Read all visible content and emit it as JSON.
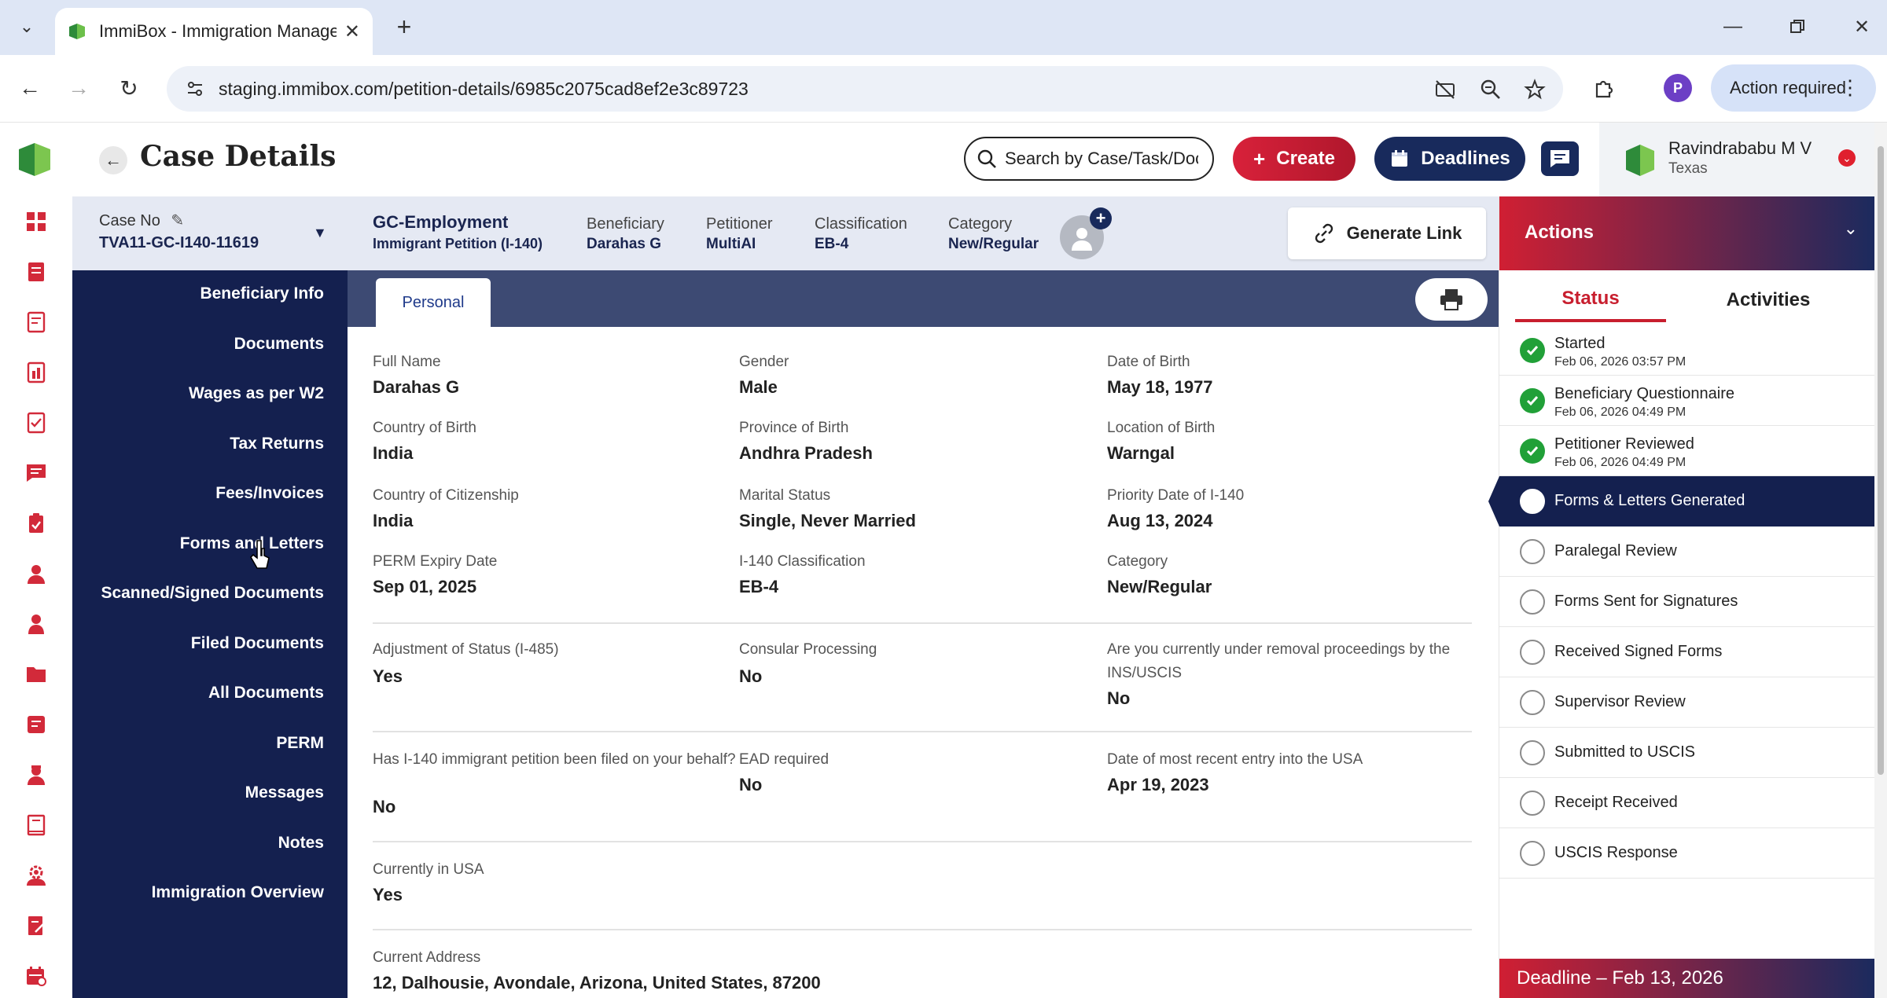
{
  "browser": {
    "tab_title": "ImmiBox - Immigration Manage",
    "url": "staging.immibox.com/petition-details/6985c2075cad8ef2e3c89723",
    "profile_initial": "P",
    "action_required": "Action required"
  },
  "header": {
    "title": "Case Details",
    "search_placeholder": "Search by Case/Task/Document",
    "create_label": "Create",
    "deadlines_label": "Deadlines",
    "user_name": "Ravindrababu M V",
    "user_location": "Texas"
  },
  "case": {
    "case_no_label": "Case No",
    "case_no": "TVA11-GC-I140-11619",
    "type_title": "GC-Employment",
    "type_subtitle": "Immigrant Petition (I-140)",
    "beneficiary_label": "Beneficiary",
    "beneficiary": "Darahas G",
    "petitioner_label": "Petitioner",
    "petitioner": "MultiAI",
    "classification_label": "Classification",
    "classification": "EB-4",
    "category_label": "Category",
    "category": "New/Regular",
    "generate_link": "Generate Link"
  },
  "side_nav": [
    "Beneficiary Info",
    "Documents",
    "Wages as per W2",
    "Tax Returns",
    "Fees/Invoices",
    "Forms and Letters",
    "Scanned/Signed Documents",
    "Filed Documents",
    "All Documents",
    "PERM",
    "Messages",
    "Notes",
    "Immigration Overview"
  ],
  "main": {
    "tab": "Personal",
    "fields": {
      "full_name": {
        "label": "Full Name",
        "value": "Darahas G"
      },
      "gender": {
        "label": "Gender",
        "value": "Male"
      },
      "dob": {
        "label": "Date of Birth",
        "value": "May 18, 1977"
      },
      "country_birth": {
        "label": "Country of Birth",
        "value": "India"
      },
      "province_birth": {
        "label": "Province of Birth",
        "value": "Andhra Pradesh"
      },
      "location_birth": {
        "label": "Location of Birth",
        "value": "Warngal"
      },
      "citizenship": {
        "label": "Country of Citizenship",
        "value": "India"
      },
      "marital": {
        "label": "Marital Status",
        "value": "Single, Never Married"
      },
      "priority_date": {
        "label": "Priority Date of I-140",
        "value": "Aug 13, 2024"
      },
      "perm_expiry": {
        "label": "PERM Expiry Date",
        "value": "Sep 01, 2025"
      },
      "i140_class": {
        "label": "I-140 Classification",
        "value": "EB-4"
      },
      "category": {
        "label": "Category",
        "value": "New/Regular"
      },
      "aos": {
        "label": "Adjustment of Status (I-485)",
        "value": "Yes"
      },
      "consular": {
        "label": "Consular Processing",
        "value": "No"
      },
      "removal": {
        "label": "Are you currently under removal proceedings by the INS/USCIS",
        "value": "No"
      },
      "i140_filed": {
        "label": "Has I-140 immigrant petition been filed on your behalf?",
        "value": "No"
      },
      "ead": {
        "label": "EAD required",
        "value": "No"
      },
      "recent_entry": {
        "label": "Date of most recent entry into the USA",
        "value": "Apr 19, 2023"
      },
      "in_usa": {
        "label": "Currently in USA",
        "value": "Yes"
      },
      "address": {
        "label": "Current Address",
        "value": "12, Dalhousie, Avondale, Arizona, United States, 87200"
      }
    }
  },
  "actions": {
    "title": "Actions",
    "tab_status": "Status",
    "tab_activities": "Activities",
    "steps": [
      {
        "name": "Started",
        "date": "Feb 06, 2026 03:57 PM"
      },
      {
        "name": "Beneficiary Questionnaire",
        "date": "Feb 06, 2026 04:49 PM"
      },
      {
        "name": "Petitioner Reviewed",
        "date": "Feb 06, 2026 04:49 PM"
      },
      {
        "name": "Forms & Letters Generated"
      },
      {
        "name": "Paralegal Review"
      },
      {
        "name": "Forms Sent for Signatures"
      },
      {
        "name": "Received Signed Forms"
      },
      {
        "name": "Supervisor Review"
      },
      {
        "name": "Submitted to USCIS"
      },
      {
        "name": "Receipt Received"
      },
      {
        "name": "USCIS Response"
      }
    ],
    "deadline": "Deadline – Feb 13, 2026"
  },
  "colors": {
    "navy": "#14204f",
    "brand_red": "#d01f33",
    "success_green": "#21a038"
  }
}
